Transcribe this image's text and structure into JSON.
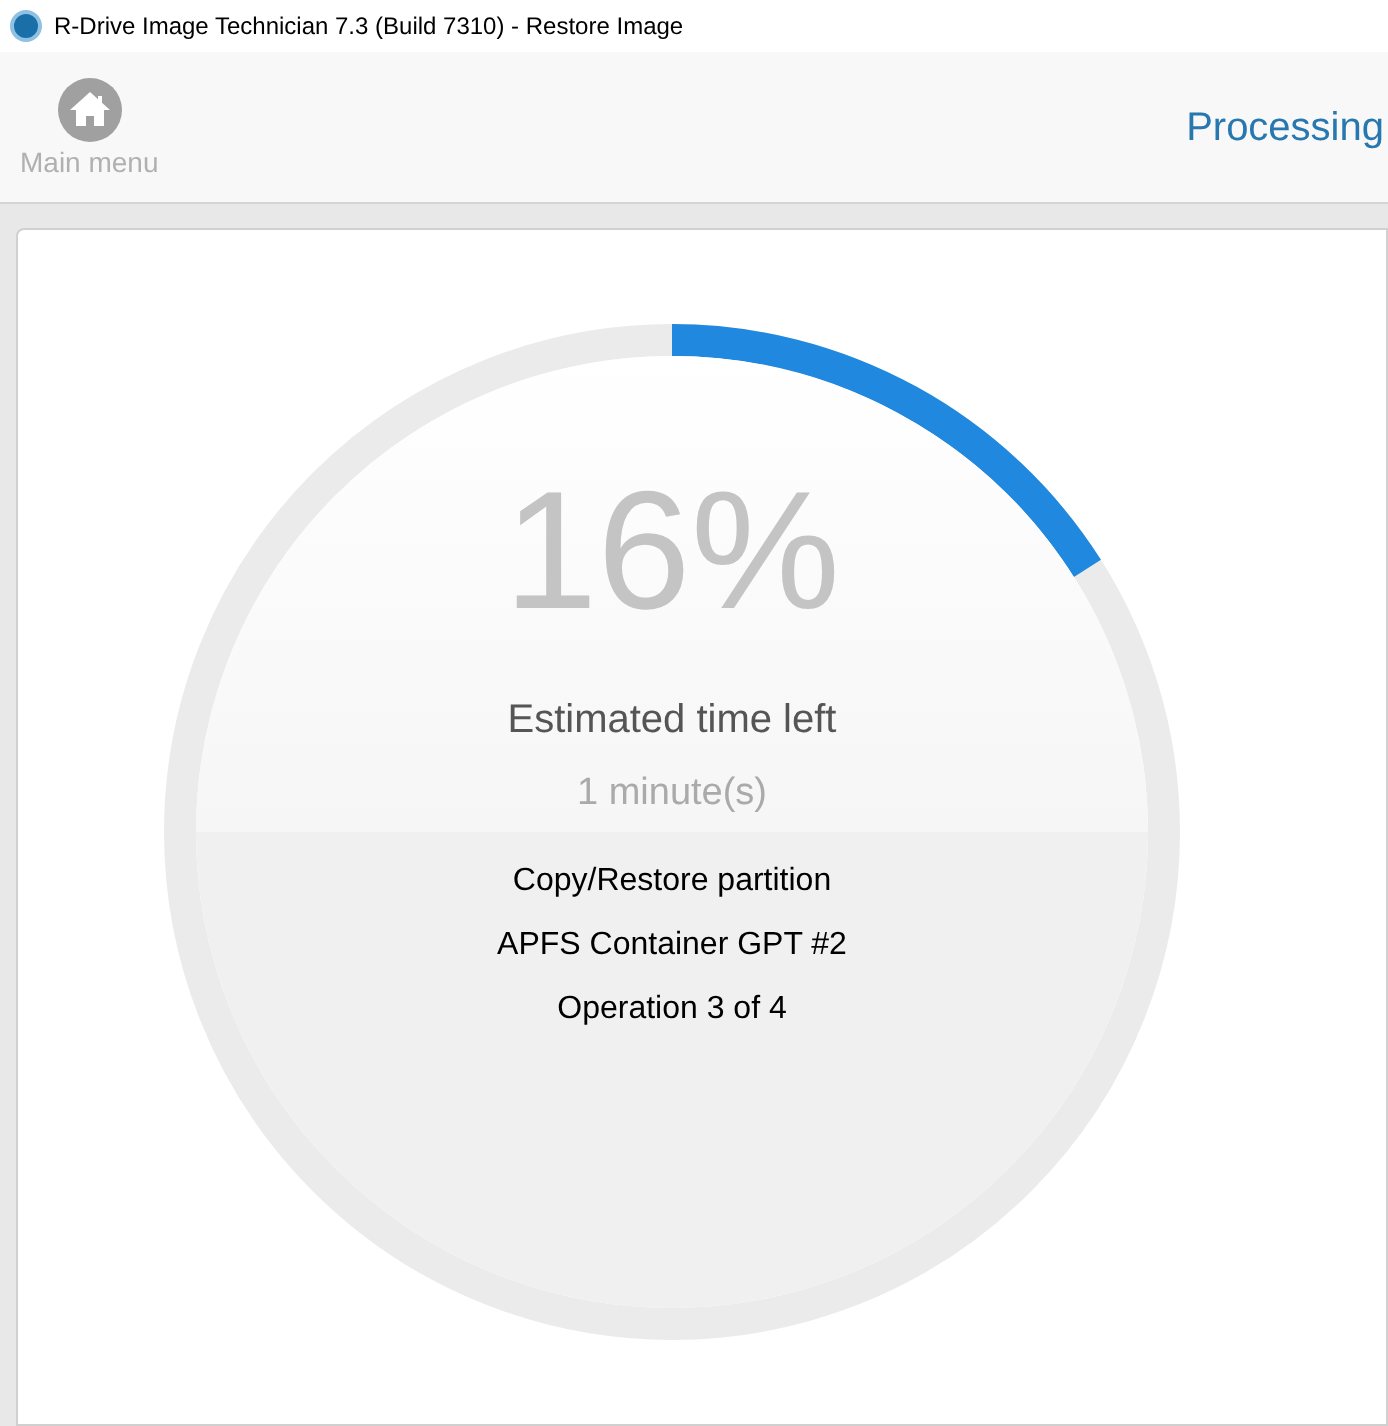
{
  "window": {
    "title": "R-Drive Image Technician 7.3 (Build 7310) - Restore Image"
  },
  "toolbar": {
    "main_menu": "Main menu",
    "step": "Processing"
  },
  "progress": {
    "level": 0.16,
    "percent": "16%",
    "time_label": "Estimated time left",
    "time_value": "1 minute(s)",
    "details": [
      "Copy/Restore partition",
      "APFS Container GPT #2",
      "Operation 3 of 4"
    ]
  }
}
